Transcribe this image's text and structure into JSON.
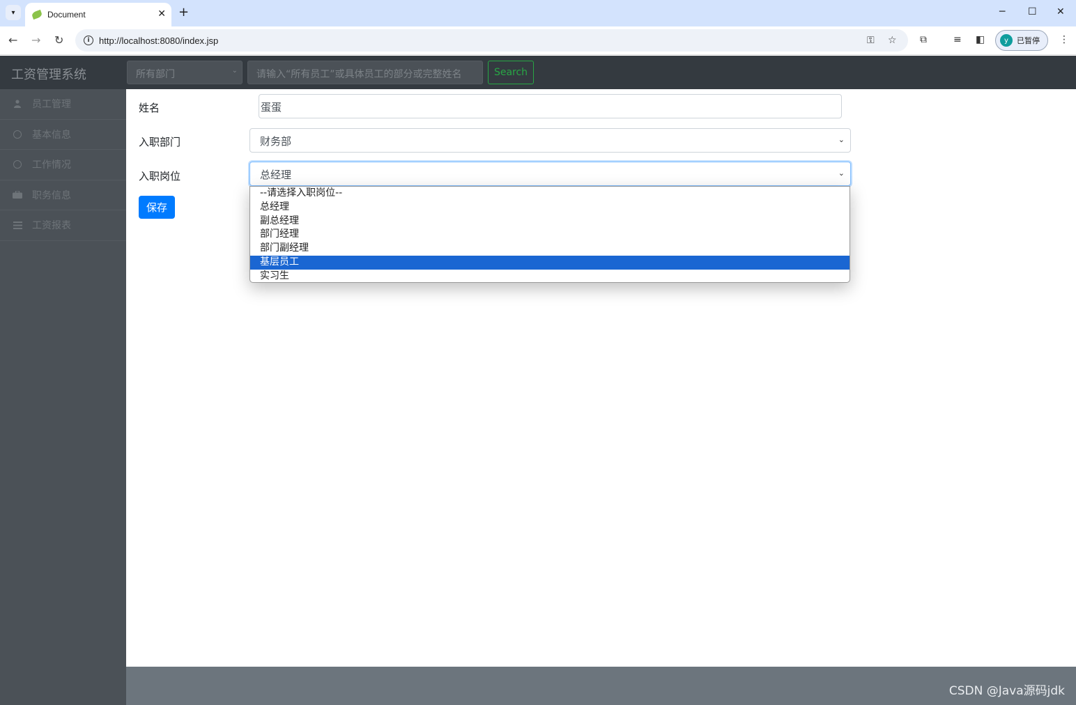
{
  "browser": {
    "tab_title": "Document",
    "url": "http://localhost:8080/index.jsp",
    "profile_initial": "y",
    "profile_status": "已暂停"
  },
  "navbar": {
    "brand": "工资管理系统",
    "dept_select_value": "所有部门",
    "search_placeholder": "请输入“所有员工”或具体员工的部分或完整姓名",
    "search_button": "Search"
  },
  "sidebar": {
    "items": [
      {
        "label": "员工管理",
        "icon": "user-icon"
      },
      {
        "label": "基本信息",
        "icon": "circle-icon"
      },
      {
        "label": "工作情况",
        "icon": "circle-icon"
      },
      {
        "label": "职务信息",
        "icon": "briefcase-icon"
      },
      {
        "label": "工资报表",
        "icon": "list-icon"
      }
    ]
  },
  "form": {
    "name_label": "姓名",
    "name_value": "蛋蛋",
    "dept_label": "入职部门",
    "dept_value": "财务部",
    "position_label": "入职岗位",
    "position_value": "总经理",
    "save_button": "保存"
  },
  "dropdown": {
    "options": [
      "--请选择入职岗位--",
      "总经理",
      "副总经理",
      "部门经理",
      "部门副经理",
      "基层员工",
      "实习生"
    ],
    "highlighted": "基层员工"
  },
  "watermark": "CSDN @Java源码jdk"
}
